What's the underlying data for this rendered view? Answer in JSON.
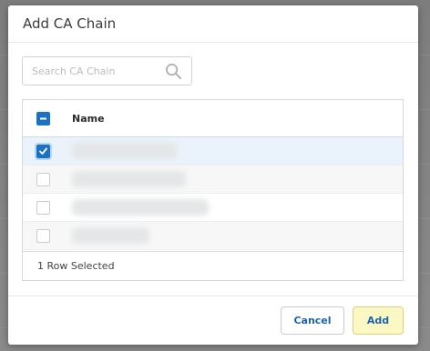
{
  "dialog": {
    "title": "Add CA Chain"
  },
  "search": {
    "placeholder": "Search CA Chain",
    "value": ""
  },
  "table": {
    "columns": [
      "Name"
    ],
    "header_select_state": "indeterminate",
    "rows": [
      {
        "checked": true,
        "name": ""
      },
      {
        "checked": false,
        "name": ""
      },
      {
        "checked": false,
        "name": ""
      },
      {
        "checked": false,
        "name": ""
      }
    ],
    "footer_status": "1 Row Selected"
  },
  "footer": {
    "cancel_label": "Cancel",
    "add_label": "Add"
  },
  "colors": {
    "accent": "#1b72c4",
    "link_text": "#1a63b0",
    "add_button_bg": "#fcf8c4",
    "selected_row_bg": "#eaf3fb"
  },
  "icons": {
    "search": "search-icon",
    "check": "check-icon",
    "minus": "minus-icon"
  }
}
